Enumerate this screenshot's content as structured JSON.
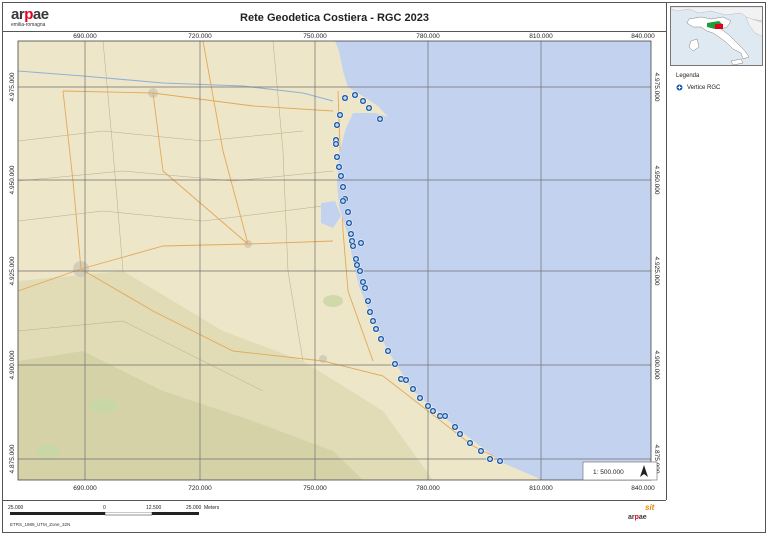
{
  "header": {
    "logo_text_a": "ar",
    "logo_text_p": "p",
    "logo_text_ae": "ae",
    "logo_sub": "emilia-romagna",
    "title": "Rete Geodetica Costiera - RGC 2023"
  },
  "grid": {
    "x_labels": [
      "690.000",
      "720.000",
      "750.000",
      "780.000",
      "810.000",
      "840.000"
    ],
    "y_labels": [
      "4.975.000",
      "4.950.000",
      "4.925.000",
      "4.900.000",
      "4.875.000"
    ]
  },
  "legend": {
    "title": "Legenda",
    "item": "Vertice RGC"
  },
  "scale": {
    "ratio": "1: 500.000",
    "bar_labels": [
      "25.000",
      "0",
      "12.500",
      "25.000"
    ],
    "unit": "Meters"
  },
  "crs": "ETRS_1989_UTM_Zone_32N",
  "footer_logo": {
    "sit": "sit",
    "arpae_a": "ar",
    "arpae_p": "p",
    "arpae_ae": "ae"
  },
  "colors": {
    "sea": "#c2d2ef",
    "land": "#eee6c8",
    "marker": "#1e5ba8",
    "grid": "#6f6f6f",
    "logo_accent": "#e2001a"
  },
  "icons": {
    "north": "north-arrow-icon",
    "marker": "plus-circle-icon"
  }
}
